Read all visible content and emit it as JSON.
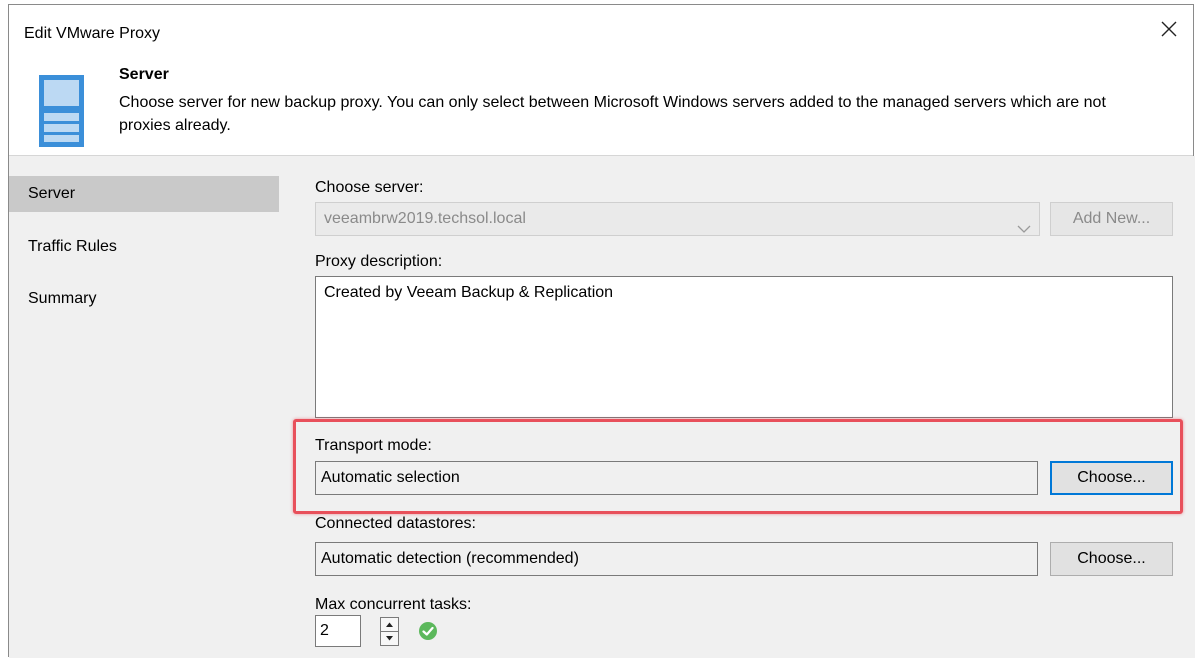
{
  "window": {
    "title": "Edit VMware Proxy",
    "close_icon": "close-icon"
  },
  "header": {
    "icon": "server-icon",
    "title": "Server",
    "description": "Choose server for new backup proxy. You can only select between Microsoft Windows servers added to the managed servers which are not proxies already."
  },
  "sidebar": {
    "items": [
      {
        "label": "Server",
        "active": true
      },
      {
        "label": "Traffic Rules",
        "active": false
      },
      {
        "label": "Summary",
        "active": false
      }
    ]
  },
  "main": {
    "choose_server": {
      "label": "Choose server:",
      "value": "veeambrw2019.techsol.local",
      "add_new_label": "Add New..."
    },
    "proxy_description": {
      "label": "Proxy description:",
      "value": "Created by Veeam Backup & Replication"
    },
    "transport_mode": {
      "label": "Transport mode:",
      "value": "Automatic selection",
      "choose_label": "Choose..."
    },
    "connected_datastores": {
      "label": "Connected datastores:",
      "value": "Automatic detection (recommended)",
      "choose_label": "Choose..."
    },
    "max_tasks": {
      "label": "Max concurrent tasks:",
      "value": "2",
      "status_icon": "check-circle-icon"
    }
  },
  "colors": {
    "highlight": "#e8505b",
    "focus": "#0078d7",
    "ok_green": "#5cb85c",
    "icon_blue": "#3b8fd9"
  }
}
